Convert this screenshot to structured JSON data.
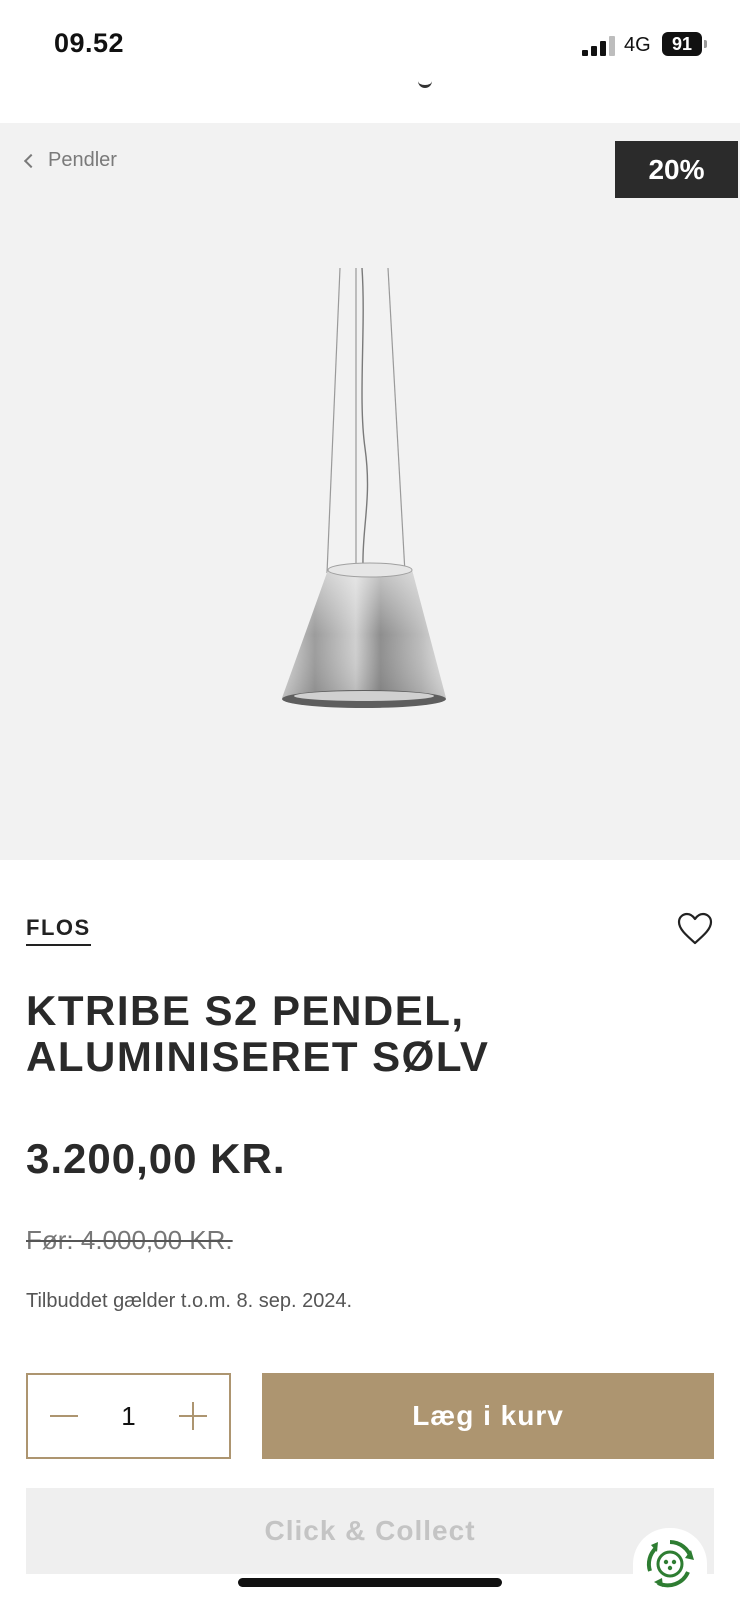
{
  "status_bar": {
    "time": "09.52",
    "network": "4G",
    "battery": "91"
  },
  "breadcrumb": {
    "label": "Pendler"
  },
  "badge": {
    "discount": "20%"
  },
  "product": {
    "brand": "FLOS",
    "title": "KTRIBE S2 PENDEL, ALUMINISERET SØLV",
    "price": "3.200,00 KR.",
    "old_price": "Før: 4.000,00 KR.",
    "offer_note": "Tilbuddet gælder t.o.m. 8. sep. 2024."
  },
  "cart": {
    "quantity": "1",
    "add_label": "Læg i kurv",
    "collect_label": "Click & Collect"
  },
  "colors": {
    "accent": "#ad9570",
    "badge_bg": "#2b2b2b",
    "hero_bg": "#f2f2f2"
  }
}
